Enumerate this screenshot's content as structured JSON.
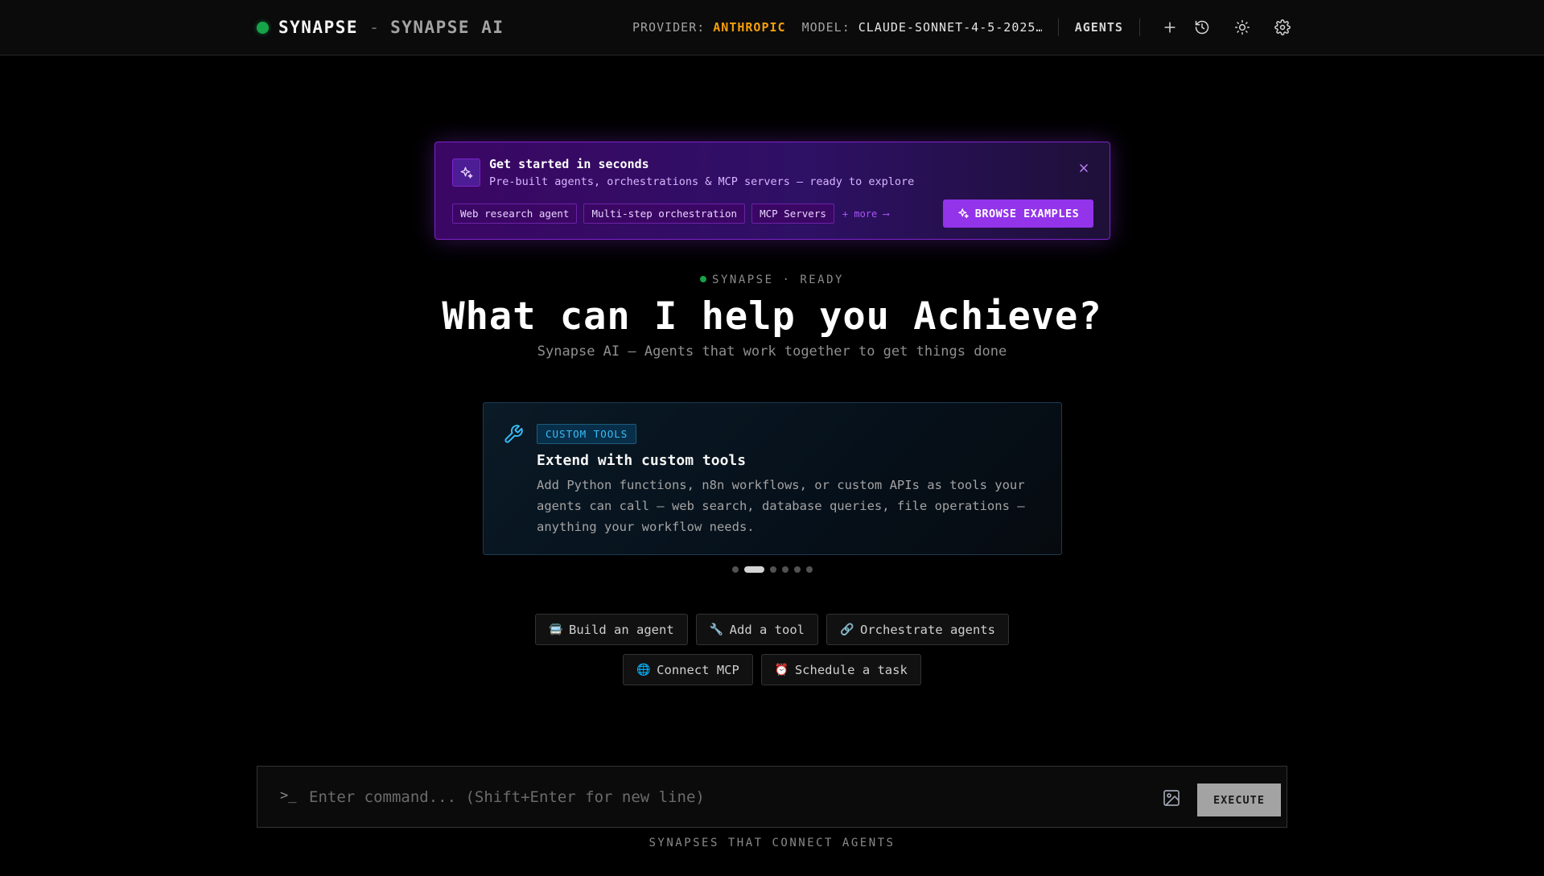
{
  "header": {
    "brand_name": "SYNAPSE",
    "brand_separator": "-",
    "brand_subtitle": "SYNAPSE AI",
    "provider_label": "PROVIDER:",
    "provider_value": "ANTHROPIC",
    "model_label": "MODEL:",
    "model_value": "CLAUDE-SONNET-4-5-2025…",
    "agents_label": "AGENTS",
    "icons": [
      "plus-icon",
      "history-icon",
      "sun-icon",
      "gear-icon"
    ]
  },
  "promo": {
    "title": "Get started in seconds",
    "subtitle": "Pre-built agents, orchestrations & MCP servers — ready to explore",
    "tags": [
      "Web research agent",
      "Multi-step orchestration",
      "MCP Servers"
    ],
    "more": "+ more ⟶",
    "button_label": "BROWSE EXAMPLES"
  },
  "hero": {
    "status": "SYNAPSE · READY",
    "title": "What can I help you Achieve?",
    "subtitle": "Synapse AI — Agents that work together to get things done"
  },
  "feature": {
    "badge": "CUSTOM TOOLS",
    "title": "Extend with custom tools",
    "description": "Add Python functions, n8n workflows, or custom APIs as tools your agents can call — web search, database queries, file operations — anything your workflow needs.",
    "carousel_total": 6,
    "carousel_active": 2
  },
  "quick_actions": {
    "row1": [
      {
        "icon": "🚍",
        "label": "Build an agent"
      },
      {
        "icon": "🔧",
        "label": "Add a tool"
      },
      {
        "icon": "🔗",
        "label": "Orchestrate agents"
      }
    ],
    "row2": [
      {
        "icon": "🌐",
        "label": "Connect MCP"
      },
      {
        "icon": "⏰",
        "label": "Schedule a task"
      }
    ]
  },
  "command": {
    "prompt_symbol": ">_",
    "placeholder": "Enter command... (Shift+Enter for new line)",
    "execute_label": "EXECUTE"
  },
  "footer": {
    "tagline": "SYNAPSES THAT CONNECT AGENTS"
  },
  "colors": {
    "accent_purple": "#9333ea",
    "status_green": "#16a34a",
    "provider_amber": "#f59e0b",
    "feature_blue": "#38bdf8"
  }
}
